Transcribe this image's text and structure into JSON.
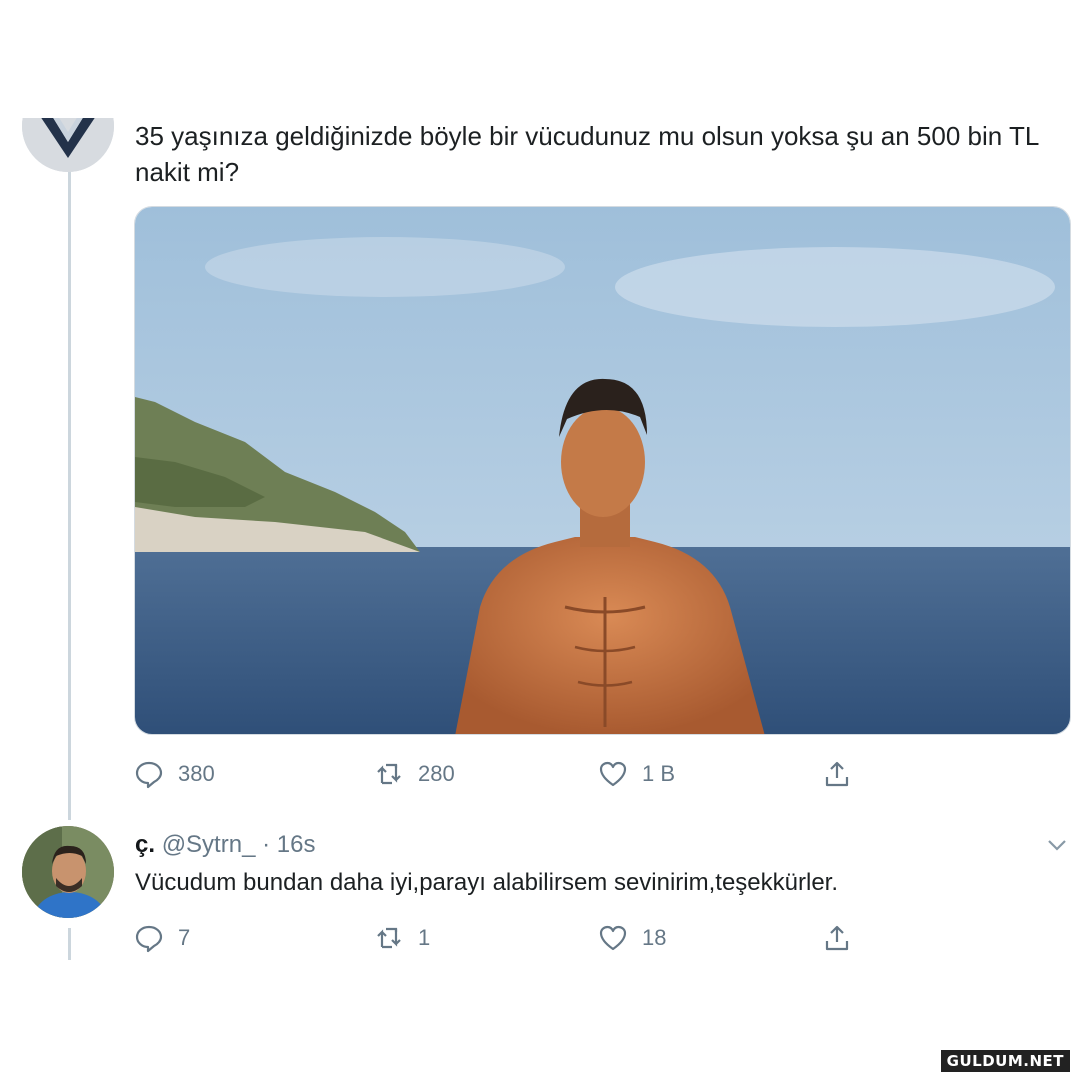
{
  "main_tweet": {
    "text": "35 yaşınıza geldiğinizde böyle bir vücudunuz mu olsun yoksa şu an 500 bin TL nakit mi?",
    "media_description_icon": "photo-shirtless-man-at-sea",
    "actions": {
      "reply_count": "380",
      "retweet_count": "280",
      "like_count": "1 B"
    }
  },
  "reply_tweet": {
    "display_name": "ç.",
    "handle": "@Sytrn_",
    "separator": "·",
    "time": "16s",
    "text": "Vücudum bundan daha iyi,parayı alabilirsem sevinirim,teşekkürler.",
    "actions": {
      "reply_count": "7",
      "retweet_count": "1",
      "like_count": "18"
    }
  },
  "watermark": "GULDUM.NET",
  "colors": {
    "icon_gray": "#657786",
    "text": "#1c2022",
    "thread_line": "#ccd6dd",
    "sky": "#a9c6de",
    "sea": "#3e5f86"
  }
}
